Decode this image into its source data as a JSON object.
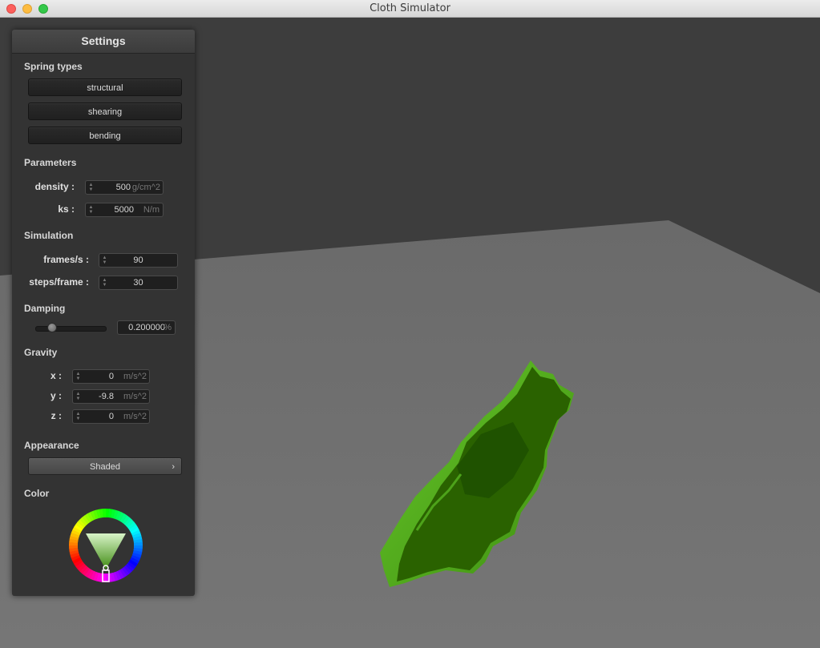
{
  "window": {
    "title": "Cloth Simulator"
  },
  "settings": {
    "title": "Settings",
    "spring_types": {
      "label": "Spring types",
      "buttons": [
        "structural",
        "shearing",
        "bending"
      ]
    },
    "parameters": {
      "label": "Parameters",
      "density": {
        "label": "density :",
        "value": "500",
        "unit": "g/cm^2"
      },
      "ks": {
        "label": "ks :",
        "value": "5000",
        "unit": "N/m"
      }
    },
    "simulation": {
      "label": "Simulation",
      "fps": {
        "label": "frames/s :",
        "value": "90"
      },
      "steps": {
        "label": "steps/frame :",
        "value": "30"
      }
    },
    "damping": {
      "label": "Damping",
      "value": "0.200000",
      "unit": "%",
      "slider_fraction": 0.2
    },
    "gravity": {
      "label": "Gravity",
      "x": {
        "label": "x :",
        "value": "0",
        "unit": "m/s^2"
      },
      "y": {
        "label": "y :",
        "value": "-9.8",
        "unit": "m/s^2"
      },
      "z": {
        "label": "z :",
        "value": "0",
        "unit": "m/s^2"
      }
    },
    "appearance": {
      "label": "Appearance",
      "selected": "Shaded"
    },
    "color": {
      "label": "Color",
      "selected_hex": "#2a6a00"
    }
  },
  "scene": {
    "cloth_color": "#2a6200",
    "cloth_highlight": "#5bbb1e",
    "plane_color": "#707070",
    "background_color": "#3d3d3d"
  }
}
